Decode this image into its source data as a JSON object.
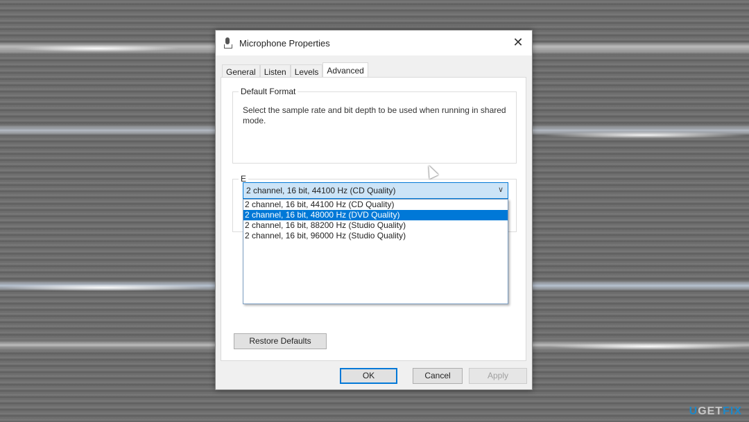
{
  "window": {
    "title": "Microphone Properties",
    "close_label": "✕"
  },
  "tabs": [
    {
      "label": "General"
    },
    {
      "label": "Listen"
    },
    {
      "label": "Levels"
    },
    {
      "label": "Advanced",
      "active": true
    }
  ],
  "default_format": {
    "group_label": "Default Format",
    "description": "Select the sample rate and bit depth to be used when running in shared mode.",
    "selected": "2 channel, 16 bit, 44100 Hz (CD Quality)",
    "options": [
      "2 channel, 16 bit, 44100 Hz (CD Quality)",
      "2 channel, 16 bit, 48000 Hz (DVD Quality)",
      "2 channel, 16 bit, 88200 Hz (Studio Quality)",
      "2 channel, 16 bit, 96000 Hz (Studio Quality)"
    ],
    "highlighted_index": 1
  },
  "exclusive_group": {
    "label_visible": "E"
  },
  "buttons": {
    "restore": "Restore Defaults",
    "ok": "OK",
    "cancel": "Cancel",
    "apply": "Apply"
  },
  "watermark": {
    "text": "UGETFIX",
    "colors": {
      "u": "#1e88c8",
      "get": "#c8c8c8",
      "fix": "#1e88c8"
    }
  },
  "colors": {
    "accent": "#0078d7",
    "combo_bg": "#cce4f7"
  }
}
